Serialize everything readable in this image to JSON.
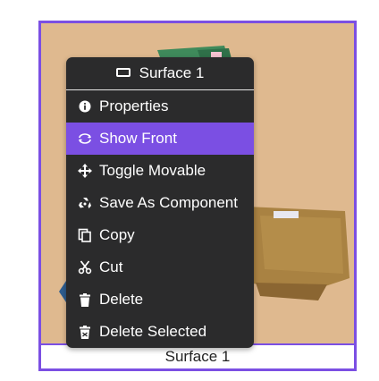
{
  "surface": {
    "caption": "Surface 1",
    "accent_color": "#7b4fe3",
    "background_color": "#dfb98f"
  },
  "context_menu": {
    "title": "Surface 1",
    "title_icon": "keyboard-icon",
    "items": [
      {
        "label": "Properties",
        "icon": "info-icon",
        "active": false
      },
      {
        "label": "Show Front",
        "icon": "rotate-icon",
        "active": true
      },
      {
        "label": "Toggle Movable",
        "icon": "move-icon",
        "active": false
      },
      {
        "label": "Save As Component",
        "icon": "recycle-icon",
        "active": false
      },
      {
        "label": "Copy",
        "icon": "copy-icon",
        "active": false
      },
      {
        "label": "Cut",
        "icon": "scissors-icon",
        "active": false
      },
      {
        "label": "Delete",
        "icon": "trash-icon",
        "active": false
      },
      {
        "label": "Delete Selected",
        "icon": "trash-selected-icon",
        "active": false
      }
    ]
  }
}
